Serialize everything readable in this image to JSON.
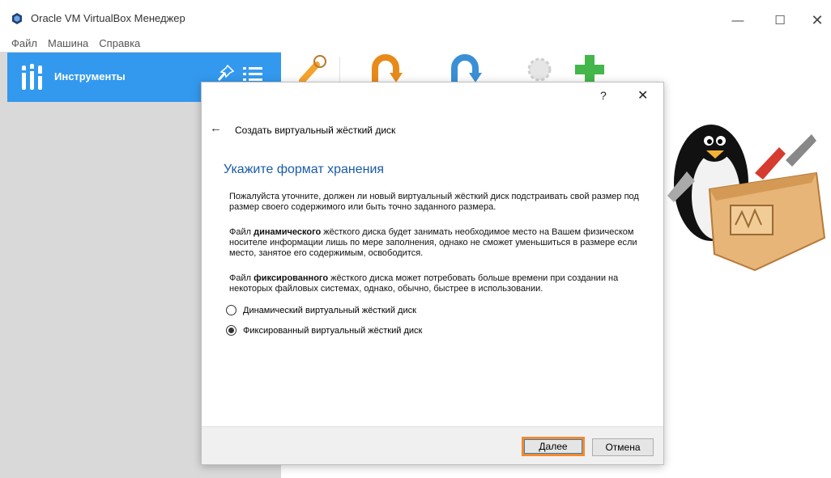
{
  "window": {
    "title": "Oracle VM VirtualBox Менеджер",
    "controls": {
      "minimize": "—",
      "maximize": "☐",
      "close": "✕"
    }
  },
  "menu": [
    "Файл",
    "Машина",
    "Справка"
  ],
  "sidebar": {
    "tools_label": "Инструменты"
  },
  "dialog": {
    "help": "?",
    "close": "✕",
    "back": "←",
    "wizard_title": "Создать виртуальный жёсткий диск",
    "heading": "Укажите формат хранения",
    "paragraph1": "Пожалуйста уточните, должен ли новый виртуальный жёсткий диск подстраивать свой размер под размер своего содержимого или быть точно заданного размера.",
    "paragraph2": {
      "prefix": "Файл ",
      "bold": "динамического",
      "suffix": " жёсткого диска будет занимать необходимое место на Вашем физическом носителе информации лишь по мере заполнения, однако не сможет уменьшиться в размере если место, занятое его содержимым, освободится."
    },
    "paragraph3": {
      "prefix": "Файл ",
      "bold": "фиксированного",
      "suffix": " жёсткого диска может потребовать больше времени при создании на некоторых файловых системах, однако, обычно, быстрее в использовании."
    },
    "options": [
      {
        "label": "Динамический виртуальный жёсткий диск",
        "checked": false
      },
      {
        "label": "Фиксированный виртуальный жёсткий диск",
        "checked": true
      }
    ],
    "buttons": {
      "next": "Далее",
      "cancel": "Отмена"
    }
  },
  "colors": {
    "accent": "#3399ee",
    "heading": "#1a5ba8",
    "highlight": "#f28a30"
  }
}
